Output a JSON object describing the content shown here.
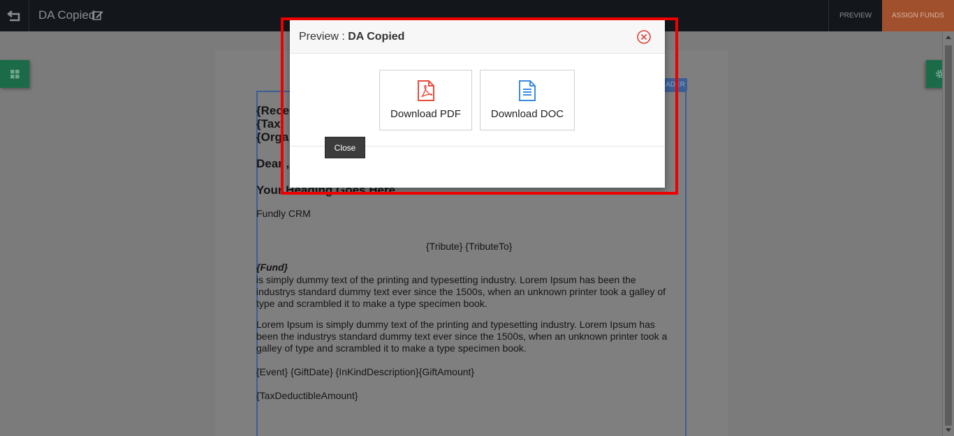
{
  "topbar": {
    "title": "DA Copied",
    "preview_label": "PREVIEW",
    "assign_funds_label": "ASSIGN FUNDS"
  },
  "document": {
    "header_tag": "ADER",
    "lines": {
      "l1": "{Rece",
      "l2": "{Tax",
      "l3": "{Orga",
      "dear": "Dear ,",
      "heading": "Your Heading Goes Here",
      "org": "Fundly CRM",
      "tribute": "{Tribute} {TributeTo}",
      "fund": "{Fund}",
      "para1": "is simply dummy text of the printing and typesetting industry. Lorem Ipsum has been the industrys standard dummy text ever since the 1500s, when an unknown printer took a galley of type and scrambled it to make a type specimen book.",
      "para2": "Lorem Ipsum is simply dummy text of the printing and typesetting industry. Lorem Ipsum has been the industrys standard dummy text ever since the 1500s, when an unknown printer took a galley of type and scrambled it to make a type specimen book.",
      "fields": "{Event} {GiftDate} {InKindDescription}{GiftAmount}",
      "tax": "{TaxDeductibleAmount}"
    }
  },
  "modal": {
    "title_prefix": "Preview : ",
    "title_name": "DA Copied",
    "download_pdf": "Download PDF",
    "download_doc": "Download DOC",
    "close_label": "Close"
  },
  "colors": {
    "accent_orange": "#a0502c",
    "accent_green": "#1b6b48",
    "highlight_red": "#ee0000",
    "pdf_red": "#e84c3d",
    "doc_blue": "#3b8be0"
  }
}
